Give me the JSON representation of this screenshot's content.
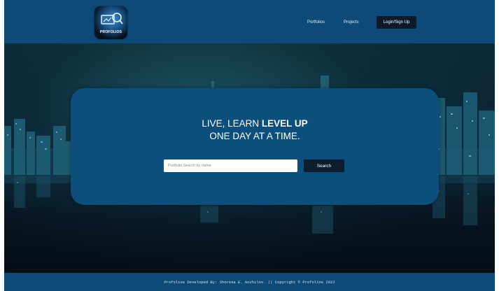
{
  "navbar": {
    "logo_text": "PROFOLIOS",
    "links": [
      {
        "label": "Portfolios"
      },
      {
        "label": "Projects"
      }
    ],
    "login_label": "Login/Sign Up"
  },
  "hero": {
    "headline_line1_prefix": "LIVE, LEARN ",
    "headline_line1_bold": "LEVEL UP",
    "headline_line2": "ONE DAY AT A TIME.",
    "search": {
      "placeholder": "Portfolio Search by name",
      "value": "",
      "button_label": "Search"
    }
  },
  "footer": {
    "text": "Profolios Developed By: Shoresa E. Anzhilov. || Copyright © Profolios 2022"
  },
  "colors": {
    "navbar_bg": "#0d4a78",
    "card_bg": "#0c4f7c",
    "button_dark": "#0b1b2c",
    "footer_bg": "#0d4a78"
  },
  "icons": [
    "profolios-logo-icon"
  ]
}
